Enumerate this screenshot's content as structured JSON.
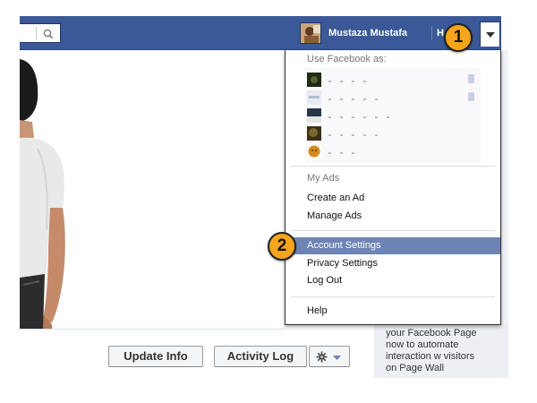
{
  "header": {
    "profile_name": "Mustaza Mustafa",
    "home_label": "H"
  },
  "callouts": {
    "step1": "1",
    "step2": "2"
  },
  "menu": {
    "use_as_heading": "Use Facebook as:",
    "pages": [
      {
        "thumb_color": "#1f2a14"
      },
      {
        "thumb_color": "#e8ebf2"
      },
      {
        "thumb_color": "#27364a"
      },
      {
        "thumb_color": "#3d3216"
      },
      {
        "thumb_color": "#d58a1e"
      }
    ],
    "ads_heading": "My Ads",
    "create_ad": "Create an Ad",
    "manage_ads": "Manage Ads",
    "account_settings": "Account Settings",
    "privacy_settings": "Privacy Settings",
    "log_out": "Log Out",
    "help": "Help"
  },
  "side_panel": {
    "text": "your Facebook Page\nnow to automate\ninteraction w visitors\non Page Wall"
  },
  "buttons": {
    "update_info": "Update Info",
    "activity_log": "Activity Log"
  },
  "colors": {
    "brand_blue": "#3b5998",
    "highlight": "#6d84b4",
    "callout": "#f7a51c"
  }
}
